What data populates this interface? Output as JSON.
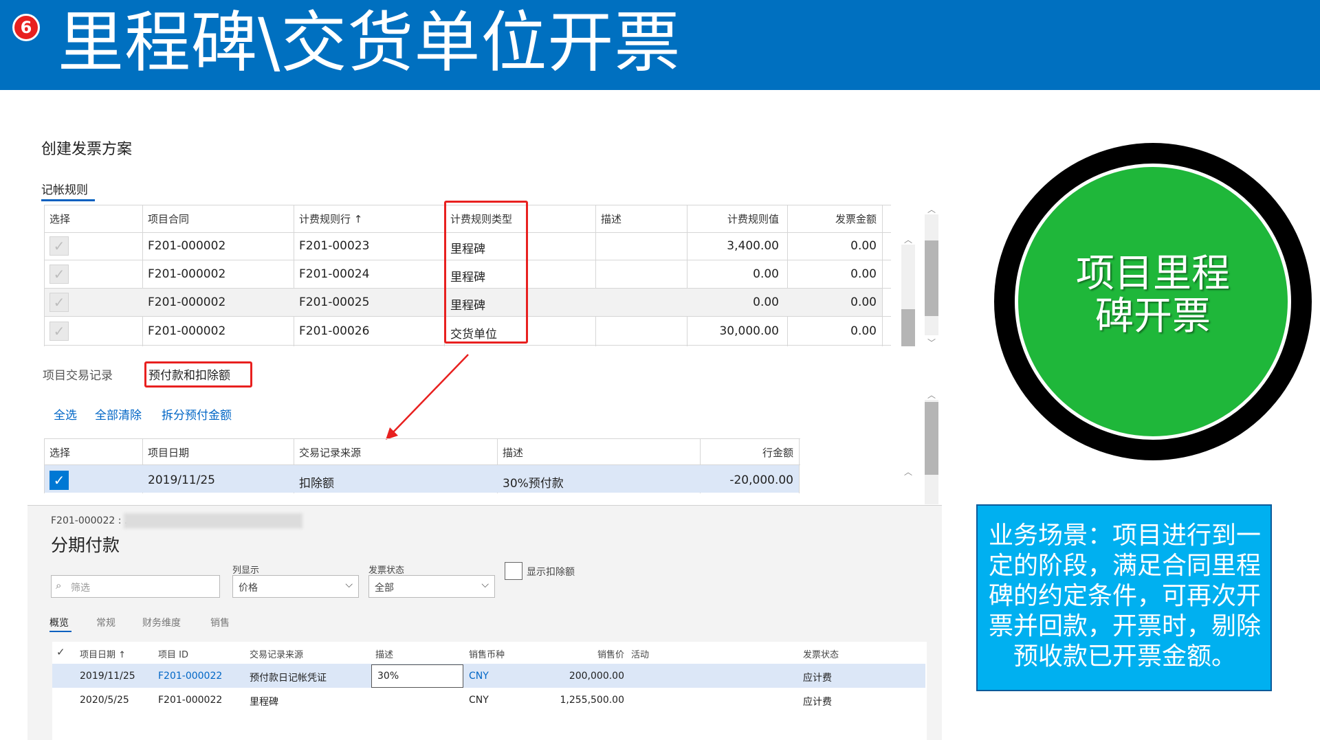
{
  "banner": {
    "badge": "6",
    "title": "里程碑\\交货单位开票"
  },
  "section_title": "创建发票方案",
  "tab_posting_rules": "记帐规则",
  "rules_table": {
    "headers": [
      "选择",
      "项目合同",
      "计费规则行 ↑",
      "计费规则类型",
      "描述",
      "计费规则值",
      "发票金额"
    ],
    "rows": [
      {
        "contract": "F201-000002",
        "line": "F201-00023",
        "type": "里程碑",
        "desc": "",
        "value": "3,400.00",
        "amount": "0.00"
      },
      {
        "contract": "F201-000002",
        "line": "F201-00024",
        "type": "里程碑",
        "desc": "",
        "value": "0.00",
        "amount": "0.00"
      },
      {
        "contract": "F201-000002",
        "line": "F201-00025",
        "type": "里程碑",
        "desc": "",
        "value": "0.00",
        "amount": "0.00"
      },
      {
        "contract": "F201-000002",
        "line": "F201-00026",
        "type": "交货单位",
        "desc": "",
        "value": "30,000.00",
        "amount": "0.00"
      }
    ]
  },
  "lower_tabs": {
    "transactions": "项目交易记录",
    "prepayments": "预付款和扣除额"
  },
  "actions": {
    "select_all": "全选",
    "clear_all": "全部清除",
    "split": "拆分预付金额"
  },
  "deduction_table": {
    "headers": [
      "选择",
      "项目日期",
      "交易记录来源",
      "描述",
      "行金额"
    ],
    "row": {
      "date": "2019/11/25",
      "source": "扣除额",
      "desc": "30%预付款",
      "amount": "-20,000.00"
    }
  },
  "installments": {
    "record_prefix": "F201-000022 : .",
    "title": "分期付款",
    "filter_placeholder": "筛选",
    "col_display_label": "列显示",
    "col_display_value": "价格",
    "invoice_status_label": "发票状态",
    "invoice_status_value": "全部",
    "show_deductions": "显示扣除额",
    "tabs": [
      "概览",
      "常规",
      "财务维度",
      "销售"
    ],
    "headers": [
      "项目日期 ↑",
      "项目 ID",
      "交易记录来源",
      "描述",
      "销售币种",
      "销售价",
      "活动",
      "发票状态"
    ],
    "rows": [
      {
        "date": "2019/11/25",
        "id": "F201-000022",
        "source": "预付款日记帐凭证",
        "desc": "30%",
        "currency": "CNY",
        "price": "200,000.00",
        "activity": "",
        "status": "应计费"
      },
      {
        "date": "2020/5/25",
        "id": "F201-000022",
        "source": "里程碑",
        "desc": "",
        "currency": "CNY",
        "price": "1,255,500.00",
        "activity": "",
        "status": "应计费"
      }
    ]
  },
  "circle_text": {
    "line1": "项目里程",
    "line2": "碑开票"
  },
  "scenario": {
    "line1": "业务场景：项目进行到一",
    "line2": "定的阶段，满足合同里程",
    "line3": "碑的约定条件，可再次开",
    "line4": "票并回款，开票时，剔除",
    "line5": "预收款已开票金额。"
  },
  "colors": {
    "banner": "#0070C0",
    "accent_red": "#E8201F",
    "green": "#1fb73a",
    "info_blue": "#00B0F0",
    "link": "#0066C6"
  }
}
